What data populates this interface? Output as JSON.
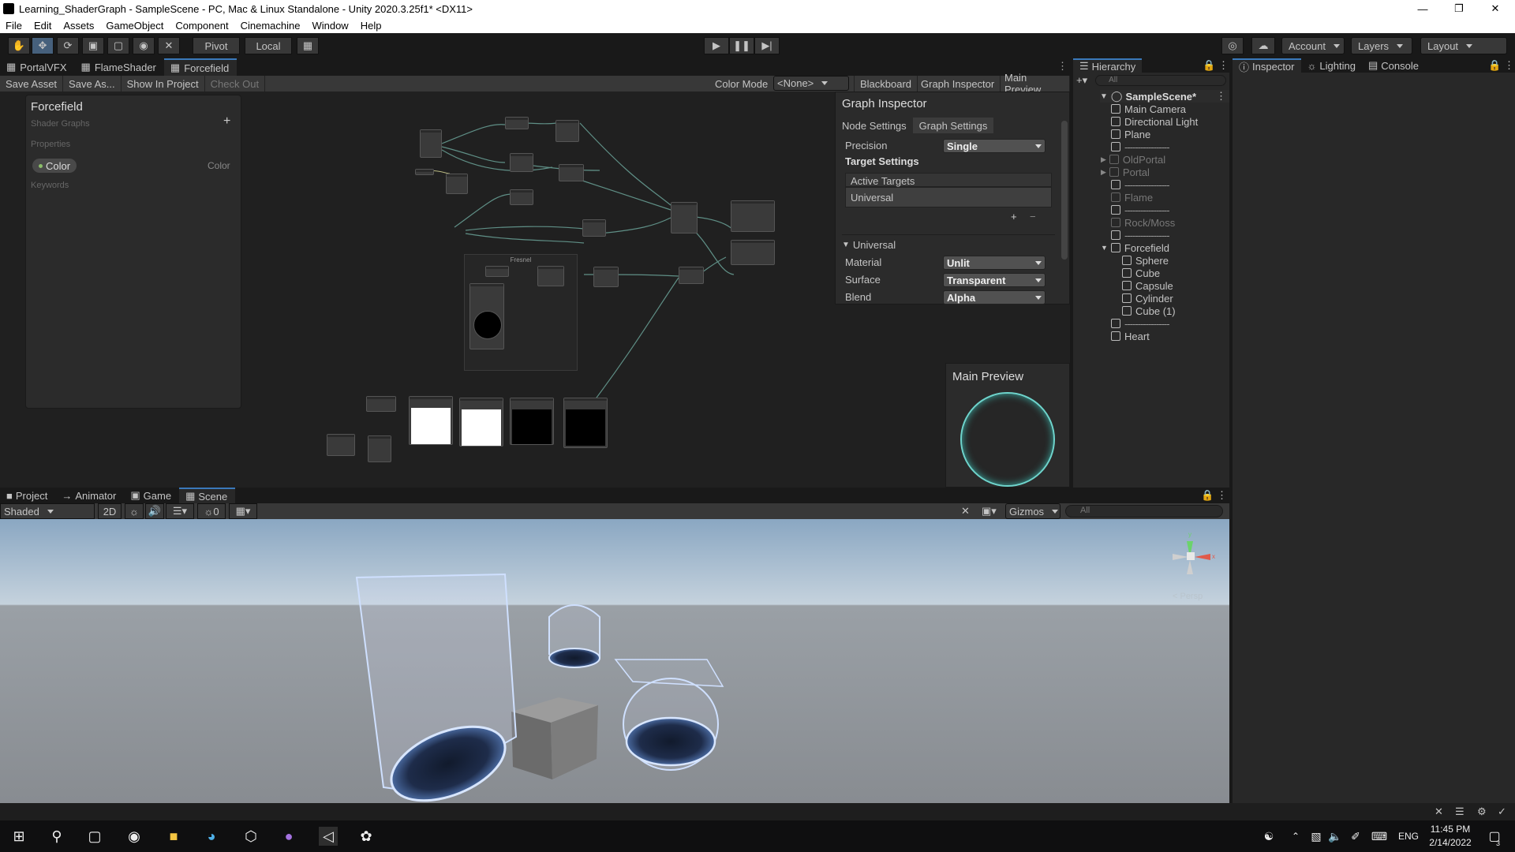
{
  "window": {
    "title": "Learning_ShaderGraph - SampleScene - PC, Mac & Linux Standalone - Unity 2020.3.25f1* <DX11>"
  },
  "menu": [
    "File",
    "Edit",
    "Assets",
    "GameObject",
    "Component",
    "Cinemachine",
    "Window",
    "Help"
  ],
  "toolbar": {
    "pivot": "Pivot",
    "local": "Local",
    "account": "Account",
    "layers": "Layers",
    "layout": "Layout"
  },
  "sg": {
    "tabs": [
      "PortalVFX",
      "FlameShader",
      "Forcefield"
    ],
    "buttons": [
      "Save Asset",
      "Save As...",
      "Show In Project",
      "Check Out"
    ],
    "color_mode_label": "Color Mode",
    "color_mode_value": "<None>",
    "toggles": [
      "Blackboard",
      "Graph Inspector",
      "Main Preview"
    ],
    "blackboard": {
      "title": "Forcefield",
      "subtitle": "Shader Graphs",
      "properties": "Properties",
      "property_name": "Color",
      "property_type": "Color",
      "keywords": "Keywords",
      "add": "+"
    },
    "fresnel_group": "Fresnel"
  },
  "inspector_panel": {
    "title": "Graph Inspector",
    "tabs": [
      "Node Settings",
      "Graph Settings"
    ],
    "precision_label": "Precision",
    "precision": "Single",
    "target_settings": "Target Settings",
    "active_targets": "Active Targets",
    "target": "Universal",
    "universal_header": "Universal",
    "material_label": "Material",
    "material": "Unlit",
    "surface_label": "Surface",
    "surface": "Transparent",
    "blend_label": "Blend",
    "blend": "Alpha"
  },
  "main_preview": {
    "title": "Main Preview"
  },
  "hierarchy": {
    "title": "Hierarchy",
    "search_placeholder": "All",
    "scene": "SampleScene*",
    "items": [
      {
        "label": "Main Camera",
        "depth": 1,
        "dim": false,
        "sep": false
      },
      {
        "label": "Directional Light",
        "depth": 1,
        "dim": false,
        "sep": false
      },
      {
        "label": "Plane",
        "depth": 1,
        "dim": false,
        "sep": false
      },
      {
        "label": "-----------------",
        "depth": 1,
        "dim": false,
        "sep": true
      },
      {
        "label": "OldPortal",
        "depth": 1,
        "dim": true,
        "sep": false
      },
      {
        "label": "Portal",
        "depth": 1,
        "dim": true,
        "sep": false
      },
      {
        "label": "-----------------",
        "depth": 1,
        "dim": false,
        "sep": true
      },
      {
        "label": "Flame",
        "depth": 1,
        "dim": true,
        "sep": false
      },
      {
        "label": "-----------------",
        "depth": 1,
        "dim": false,
        "sep": true
      },
      {
        "label": "Rock/Moss",
        "depth": 1,
        "dim": true,
        "sep": false
      },
      {
        "label": "-----------------",
        "depth": 1,
        "dim": false,
        "sep": true
      },
      {
        "label": "Forcefield",
        "depth": 1,
        "dim": false,
        "sep": false
      },
      {
        "label": "Sphere",
        "depth": 2,
        "dim": false,
        "sep": false
      },
      {
        "label": "Cube",
        "depth": 2,
        "dim": false,
        "sep": false
      },
      {
        "label": "Capsule",
        "depth": 2,
        "dim": false,
        "sep": false
      },
      {
        "label": "Cylinder",
        "depth": 2,
        "dim": false,
        "sep": false
      },
      {
        "label": "Cube (1)",
        "depth": 2,
        "dim": false,
        "sep": false
      },
      {
        "label": "-----------------",
        "depth": 1,
        "dim": false,
        "sep": true
      },
      {
        "label": "Heart",
        "depth": 1,
        "dim": false,
        "sep": false
      }
    ]
  },
  "right_tabs": [
    "Inspector",
    "Lighting",
    "Console"
  ],
  "bottom_tabs": [
    "Project",
    "Animator",
    "Game",
    "Scene"
  ],
  "scene_toolbar": {
    "shading": "Shaded",
    "mode2d": "2D",
    "hidden_count": "0",
    "gizmos": "Gizmos",
    "search_placeholder": "All"
  },
  "scene": {
    "persp": "< Persp"
  },
  "taskbar": {
    "time": "11:45 PM",
    "date": "2/14/2022",
    "lang": "ENG",
    "notif": "3"
  }
}
